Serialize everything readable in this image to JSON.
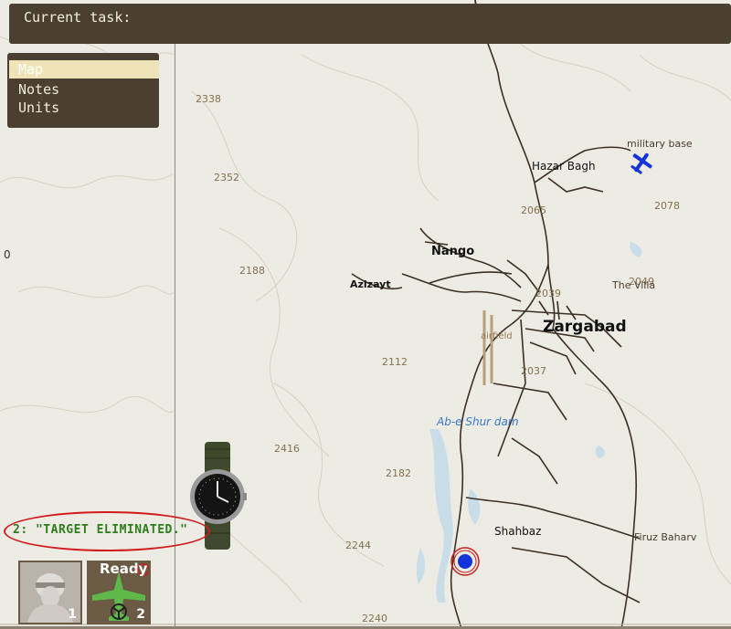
{
  "task_bar": {
    "label": "Current task:"
  },
  "menu": {
    "items": [
      {
        "label": "Map"
      },
      {
        "label": "Notes"
      },
      {
        "label": "Units"
      }
    ]
  },
  "map": {
    "grid_labels": [
      "2187",
      "2338",
      "2352",
      "2188",
      "2416",
      "2112",
      "2182",
      "2244",
      "2240",
      "2065",
      "2039",
      "2037",
      "2078",
      "2049",
      "0"
    ],
    "towns": [
      "Zargabad",
      "Nango",
      "Azizayt",
      "Hazar Bagh",
      "Shahbaz",
      "Firuz Baharv",
      "The Villa",
      "military base",
      "airfield"
    ],
    "water": [
      "Ab-e Shur dam"
    ]
  },
  "chat": {
    "message": "2: \"TARGET ELIMINATED.\""
  },
  "units": [
    {
      "number": "1"
    },
    {
      "number": "2",
      "status": "Ready"
    }
  ],
  "colors": {
    "panel": "#4a3f31",
    "selected": "#efe4b8",
    "chat_text": "#2d7d1c",
    "chat_ring": "#d31a1a",
    "road": "#3b3023",
    "player": "#1433d9"
  },
  "icons": {
    "plane": "plane-icon",
    "player": "player-marker-icon",
    "watch": "watch-icon"
  }
}
